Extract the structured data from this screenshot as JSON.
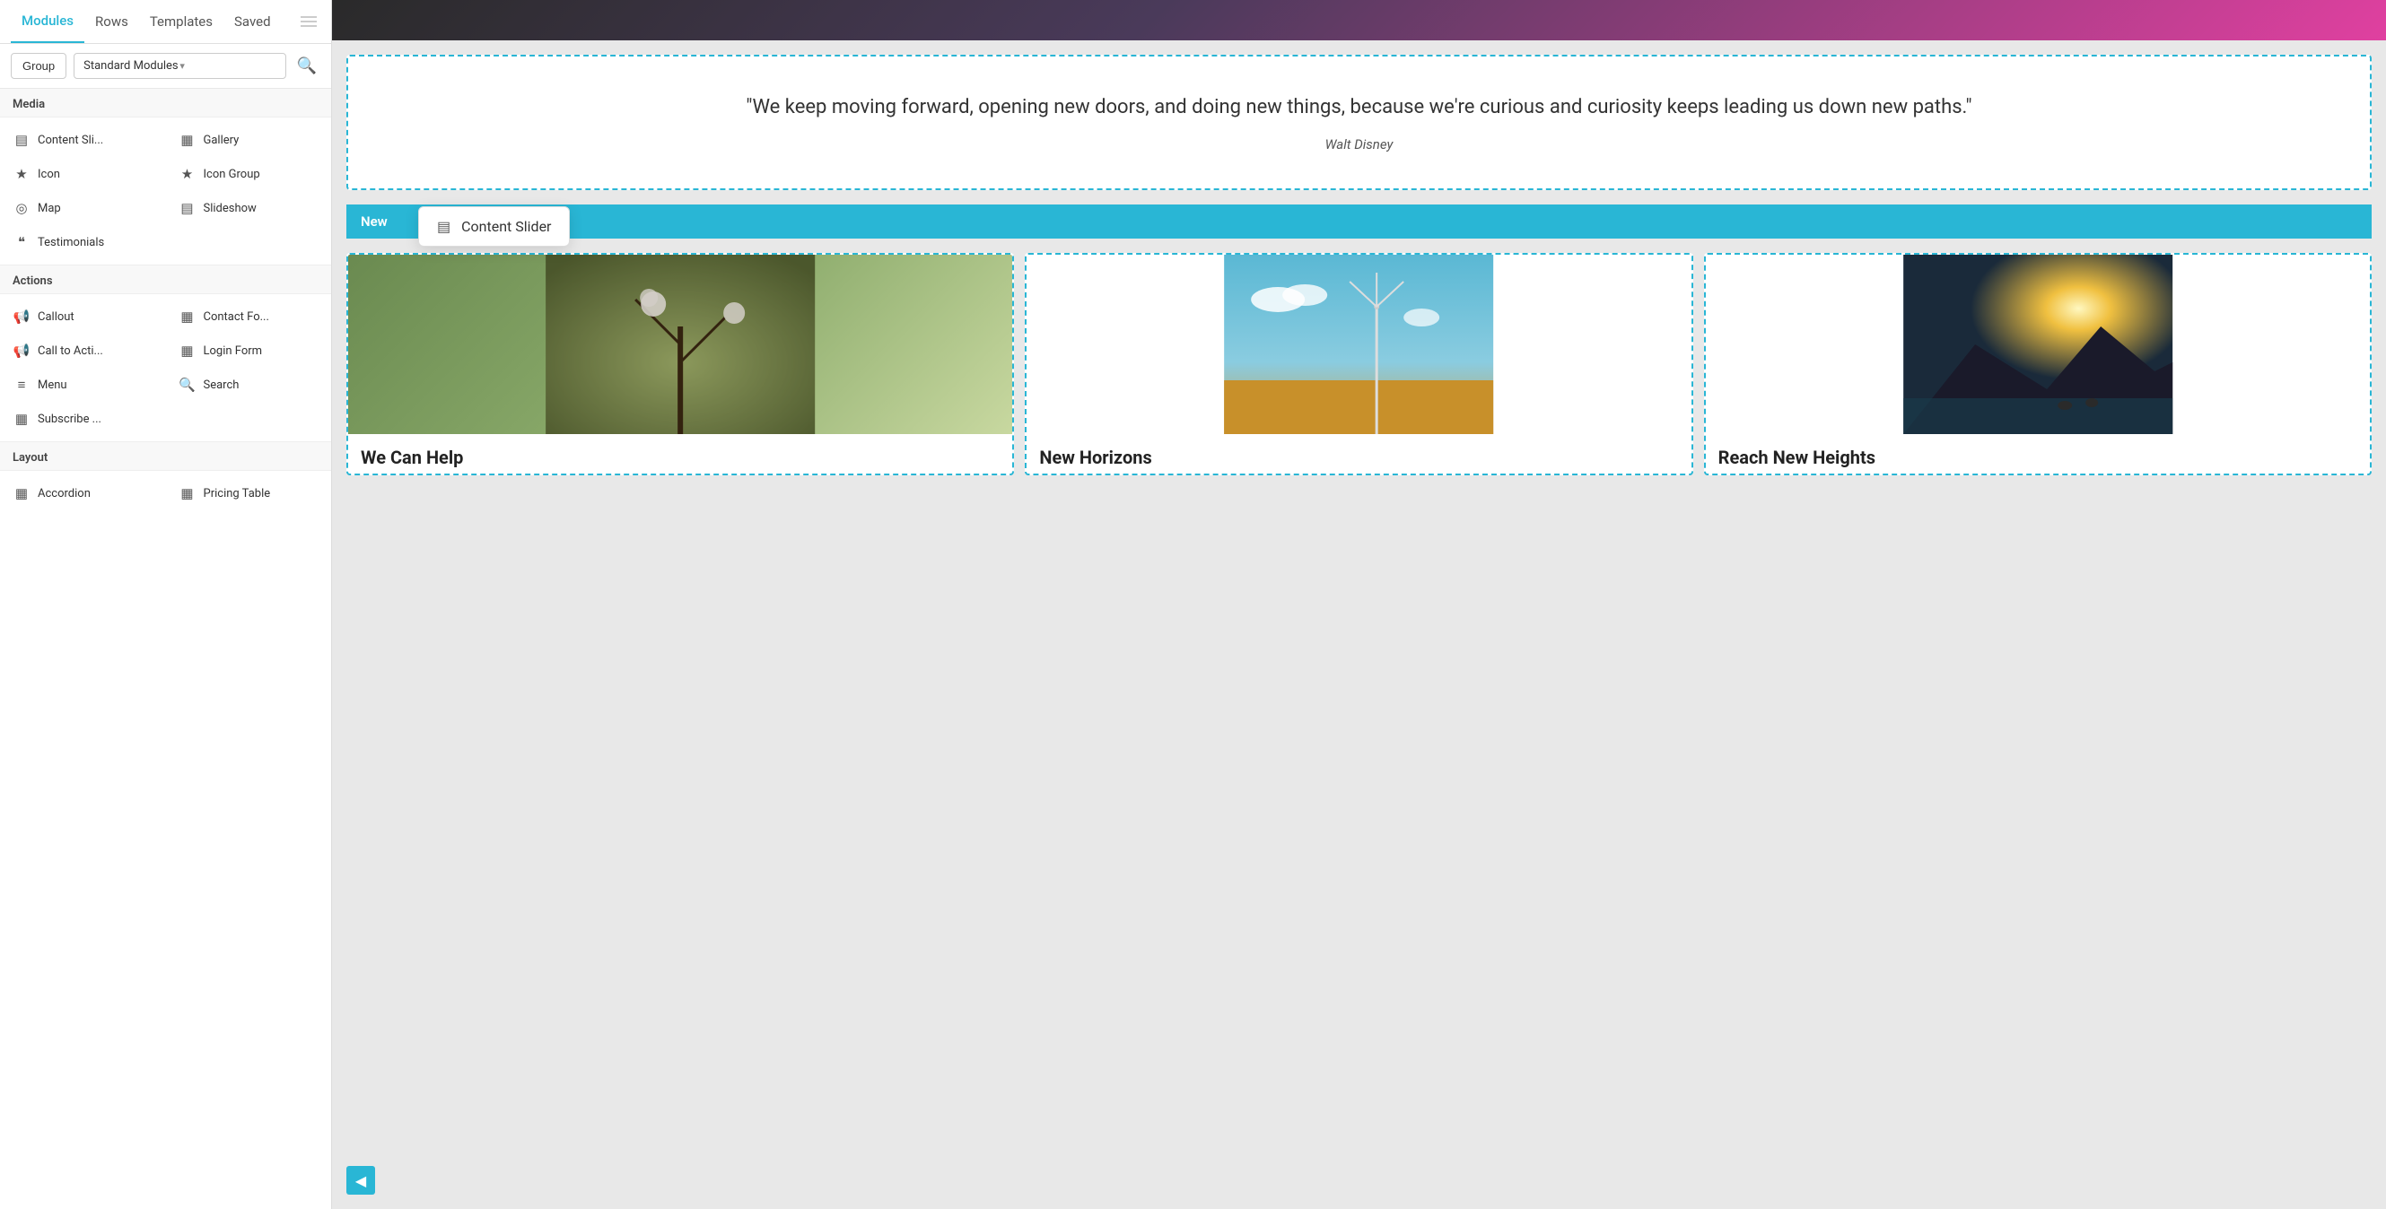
{
  "nav": {
    "tabs": [
      {
        "id": "modules",
        "label": "Modules",
        "active": true
      },
      {
        "id": "rows",
        "label": "Rows",
        "active": false
      },
      {
        "id": "templates",
        "label": "Templates",
        "active": false
      },
      {
        "id": "saved",
        "label": "Saved",
        "active": false
      }
    ]
  },
  "filter": {
    "group_label": "Group",
    "module_select": "Standard Modules",
    "search_icon": "🔍"
  },
  "media_section": {
    "header": "Media",
    "items": [
      {
        "id": "content-slider",
        "label": "Content Sli...",
        "icon": "▤"
      },
      {
        "id": "gallery",
        "label": "Gallery",
        "icon": "▦"
      },
      {
        "id": "icon",
        "label": "Icon",
        "icon": "★"
      },
      {
        "id": "icon-group",
        "label": "Icon Group",
        "icon": "★"
      },
      {
        "id": "map",
        "label": "Map",
        "icon": "📍"
      },
      {
        "id": "slideshow",
        "label": "Slideshow",
        "icon": "▤"
      },
      {
        "id": "testimonials",
        "label": "Testimonials",
        "icon": "❝"
      }
    ]
  },
  "actions_section": {
    "header": "Actions",
    "items": [
      {
        "id": "callout",
        "label": "Callout",
        "icon": "📢"
      },
      {
        "id": "contact-form",
        "label": "Contact Fo...",
        "icon": "▦"
      },
      {
        "id": "call-to-action",
        "label": "Call to Acti...",
        "icon": "📢"
      },
      {
        "id": "login-form",
        "label": "Login Form",
        "icon": "▦"
      },
      {
        "id": "menu",
        "label": "Menu",
        "icon": "≡"
      },
      {
        "id": "search",
        "label": "Search",
        "icon": "🔍"
      },
      {
        "id": "subscribe",
        "label": "Subscribe ...",
        "icon": "▦"
      }
    ]
  },
  "layout_section": {
    "header": "Layout",
    "items": [
      {
        "id": "accordion",
        "label": "Accordion",
        "icon": "▦"
      },
      {
        "id": "pricing-table",
        "label": "Pricing Table",
        "icon": "▦"
      }
    ]
  },
  "quote": {
    "text": "\"We keep moving forward, opening new doors, and doing new things, because we're curious and curiosity keeps leading us down new paths.\"",
    "author": "Walt Disney"
  },
  "new_badge": "New",
  "tooltip": {
    "label": "Content Slider",
    "icon": "▤"
  },
  "cards": [
    {
      "title": "We Can Help",
      "img_color": "#8aaa6a"
    },
    {
      "title": "New Horizons",
      "img_color": "#7aabcc"
    },
    {
      "title": "Reach New Heights",
      "img_color": "#c4a06a"
    }
  ]
}
